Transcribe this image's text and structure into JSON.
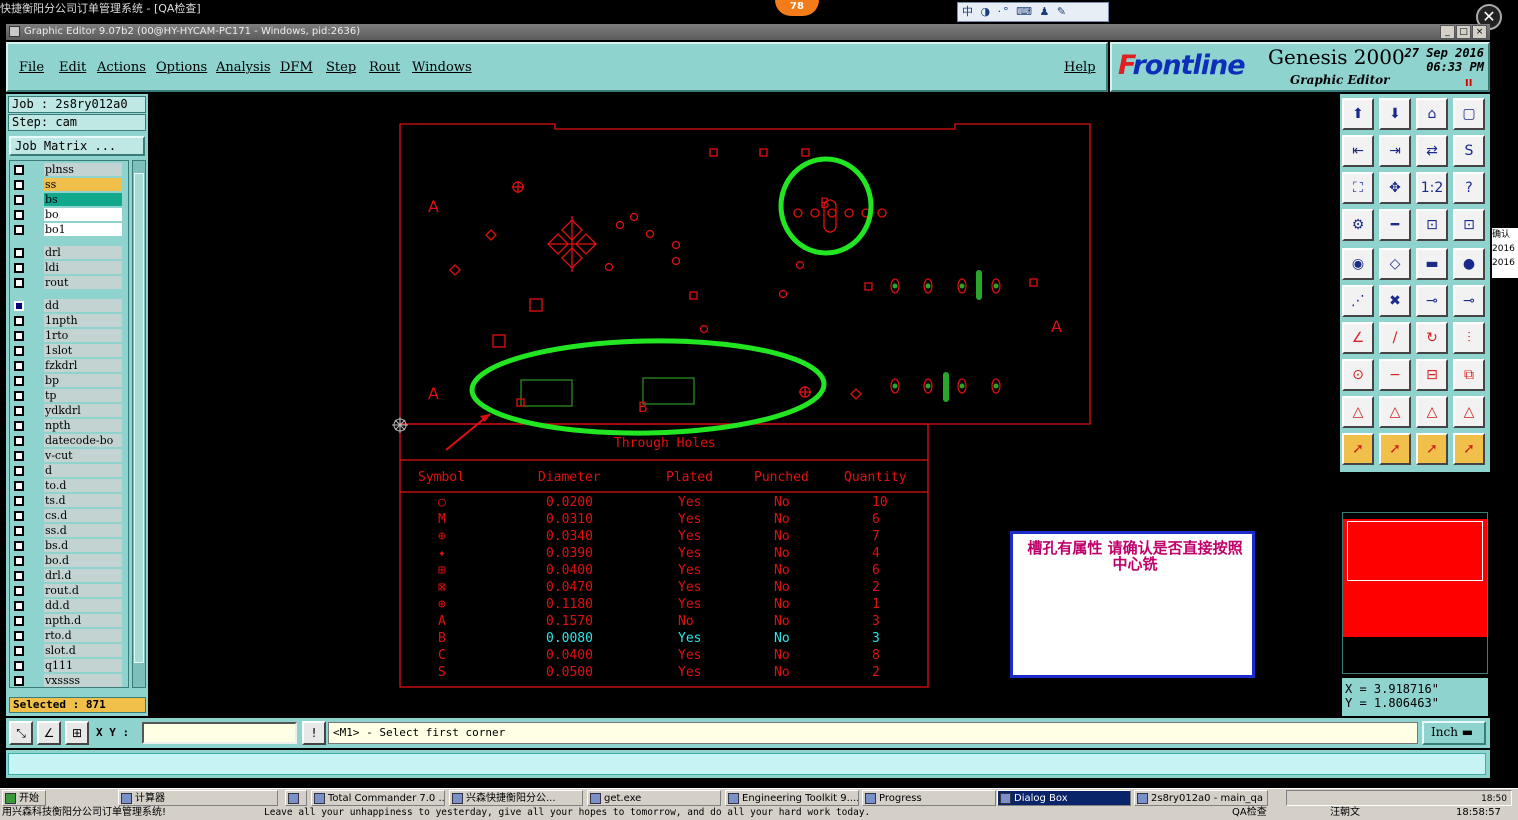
{
  "os": {
    "title": "快捷衡阳分公司订单管理系统 - [QA检查]",
    "badge": "78",
    "ime": "中 ◑ ·° ⌨ ♟ ✎"
  },
  "app": {
    "title": "Graphic Editor 9.07b2 (00@HY-HYCAM-PC171 - Windows, pid:2636)"
  },
  "menu": {
    "items": [
      "File",
      "Edit",
      "Actions",
      "Options",
      "Analysis",
      "DFM",
      "Step",
      "Rout",
      "Windows"
    ],
    "help": "Help"
  },
  "logo": {
    "brand_prefix": "F",
    "brand_rest": "rontline",
    "product": "Genesis 2000",
    "subtitle": "Graphic Editor",
    "date_line1": "27 Sep 2016",
    "date_line2": "06:33 PM"
  },
  "left": {
    "job": "Job : 2s8ry012a0",
    "step": "Step: cam",
    "job_matrix": "Job Matrix ...",
    "layers": [
      {
        "name": "plnss",
        "color": "#c2d3d2",
        "group": 0
      },
      {
        "name": "ss",
        "color": "#f0c04a",
        "group": 0
      },
      {
        "name": "bs",
        "color": "#12a88e",
        "group": 0
      },
      {
        "name": "bo",
        "color": "#ffffff",
        "group": 0
      },
      {
        "name": "bo1",
        "color": "#ffffff",
        "group": 0
      },
      {
        "name": "drl",
        "color": "#c2d3d2",
        "group": 1
      },
      {
        "name": "ldi",
        "color": "#c2d3d2",
        "group": 1
      },
      {
        "name": "rout",
        "color": "#c2d3d2",
        "group": 1
      },
      {
        "name": "dd",
        "color": "#c2d3d2",
        "group": 2,
        "selected": true
      },
      {
        "name": "1npth",
        "color": "#c2d3d2",
        "group": 2
      },
      {
        "name": "1rto",
        "color": "#c2d3d2",
        "group": 2
      },
      {
        "name": "1slot",
        "color": "#c2d3d2",
        "group": 2
      },
      {
        "name": "fzkdrl",
        "color": "#c2d3d2",
        "group": 2
      },
      {
        "name": "bp",
        "color": "#c2d3d2",
        "group": 2
      },
      {
        "name": "tp",
        "color": "#c2d3d2",
        "group": 2
      },
      {
        "name": "ydkdrl",
        "color": "#c2d3d2",
        "group": 2
      },
      {
        "name": "npth",
        "color": "#c2d3d2",
        "group": 2
      },
      {
        "name": "datecode-bo",
        "color": "#c2d3d2",
        "group": 2
      },
      {
        "name": "v-cut",
        "color": "#c2d3d2",
        "group": 2
      },
      {
        "name": "d",
        "color": "#c2d3d2",
        "group": 2
      },
      {
        "name": "to.d",
        "color": "#c2d3d2",
        "group": 2
      },
      {
        "name": "ts.d",
        "color": "#c2d3d2",
        "group": 2
      },
      {
        "name": "cs.d",
        "color": "#c2d3d2",
        "group": 2
      },
      {
        "name": "ss.d",
        "color": "#c2d3d2",
        "group": 2
      },
      {
        "name": "bs.d",
        "color": "#c2d3d2",
        "group": 2
      },
      {
        "name": "bo.d",
        "color": "#c2d3d2",
        "group": 2
      },
      {
        "name": "drl.d",
        "color": "#c2d3d2",
        "group": 2
      },
      {
        "name": "rout.d",
        "color": "#c2d3d2",
        "group": 2
      },
      {
        "name": "dd.d",
        "color": "#c2d3d2",
        "group": 2
      },
      {
        "name": "npth.d",
        "color": "#c2d3d2",
        "group": 2
      },
      {
        "name": "rto.d",
        "color": "#c2d3d2",
        "group": 2
      },
      {
        "name": "slot.d",
        "color": "#c2d3d2",
        "group": 2
      },
      {
        "name": "q111",
        "color": "#c2d3d2",
        "group": 2
      },
      {
        "name": "vxssss",
        "color": "#c2d3d2",
        "group": 2
      }
    ],
    "selected": "Selected : 871"
  },
  "canvas": {
    "labels": [
      "A",
      "A",
      "A",
      "B",
      "B"
    ],
    "table": {
      "title": "Through Holes",
      "headers": [
        "Symbol",
        "Diameter",
        "Plated",
        "Punched",
        "Quantity"
      ],
      "rows": [
        {
          "symbol": "○",
          "diameter": "0.0200",
          "plated": "Yes",
          "punched": "No",
          "quantity": "10",
          "highlight": false
        },
        {
          "symbol": "M",
          "diameter": "0.0310",
          "plated": "Yes",
          "punched": "No",
          "quantity": "6",
          "highlight": false
        },
        {
          "symbol": "⊕",
          "diameter": "0.0340",
          "plated": "Yes",
          "punched": "No",
          "quantity": "7",
          "highlight": false
        },
        {
          "symbol": "✦",
          "diameter": "0.0390",
          "plated": "Yes",
          "punched": "No",
          "quantity": "4",
          "highlight": false
        },
        {
          "symbol": "⊞",
          "diameter": "0.0400",
          "plated": "Yes",
          "punched": "No",
          "quantity": "6",
          "highlight": false
        },
        {
          "symbol": "⊠",
          "diameter": "0.0470",
          "plated": "Yes",
          "punched": "No",
          "quantity": "2",
          "highlight": false
        },
        {
          "symbol": "⊕",
          "diameter": "0.1180",
          "plated": "Yes",
          "punched": "No",
          "quantity": "1",
          "highlight": false
        },
        {
          "symbol": "A",
          "diameter": "0.1570",
          "plated": "No",
          "punched": "No",
          "quantity": "3",
          "highlight": false
        },
        {
          "symbol": "B",
          "diameter": "0.0080",
          "plated": "Yes",
          "punched": "No",
          "quantity": "3",
          "highlight": true
        },
        {
          "symbol": "C",
          "diameter": "0.0400",
          "plated": "Yes",
          "punched": "No",
          "quantity": "8",
          "highlight": false
        },
        {
          "symbol": "S",
          "diameter": "0.0500",
          "plated": "Yes",
          "punched": "No",
          "quantity": "2",
          "highlight": false
        }
      ]
    },
    "note": "槽孔有属性 请确认是否直接按照中心铣"
  },
  "coords": {
    "x": "X = 3.918716\"",
    "y": "Y = 1.806463\""
  },
  "cmd": {
    "xy_label": "X Y :",
    "xy_value": "",
    "prompt": "<M1> - Select first corner",
    "unit": "Inch"
  },
  "peek": {
    "line1": "确认",
    "line2": "2016",
    "line3": "2016"
  },
  "taskbar": {
    "start": "开始",
    "items": [
      {
        "label": "计算器",
        "active": false
      },
      {
        "label": "",
        "active": false
      },
      {
        "label": "Total Commander 7.0 ...",
        "active": false
      },
      {
        "label": "兴森快捷衡阳分公...",
        "active": false
      },
      {
        "label": "get.exe",
        "active": false
      },
      {
        "label": "Engineering Toolkit 9....",
        "active": false
      },
      {
        "label": "Progress",
        "active": false
      },
      {
        "label": "Dialog Box",
        "active": true
      },
      {
        "label": "2s8ry012a0 - main_qa",
        "active": false
      }
    ],
    "tray_time": "18:50"
  },
  "status": {
    "left": "用兴森科技衡阳分公司订单管理系统!",
    "motto": "Leave all your unhappiness to yesterday, give all your hopes to tomorrow, and do all your hard work today.",
    "qa": "QA检查",
    "user": "汪朝文",
    "time": "18:58:57"
  },
  "colors": {
    "panel": "#8fd3cf",
    "layout_red": "#e01010",
    "callout_green": "#22e622",
    "highlight_cyan": "#28e6e6"
  }
}
